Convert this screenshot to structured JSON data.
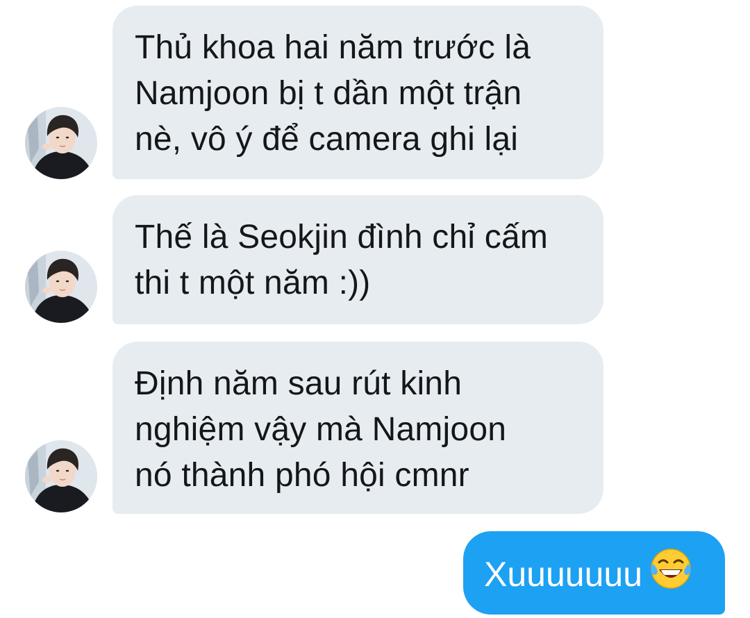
{
  "messages": [
    {
      "direction": "incoming",
      "lines": [
        "Thủ khoa hai năm trước là",
        "Namjoon bị t dần một trận",
        "nè, vô ý để camera ghi lại"
      ]
    },
    {
      "direction": "incoming",
      "lines": [
        "Thế là Seokjin đình chỉ cấm",
        "thi t một năm :))"
      ]
    },
    {
      "direction": "incoming",
      "lines": [
        "Định năm sau rút kinh",
        "nghiệm vậy mà Namjoon",
        "nó thành phó hội cmnr"
      ]
    },
    {
      "direction": "outgoing",
      "text": "Xuuuuuuu",
      "emoji": "face-with-tears-of-joy-icon"
    }
  ],
  "colors": {
    "incoming_bubble": "#e6ecf0",
    "outgoing_bubble": "#1da1f2",
    "incoming_text": "#14171a",
    "outgoing_text": "#ffffff"
  }
}
